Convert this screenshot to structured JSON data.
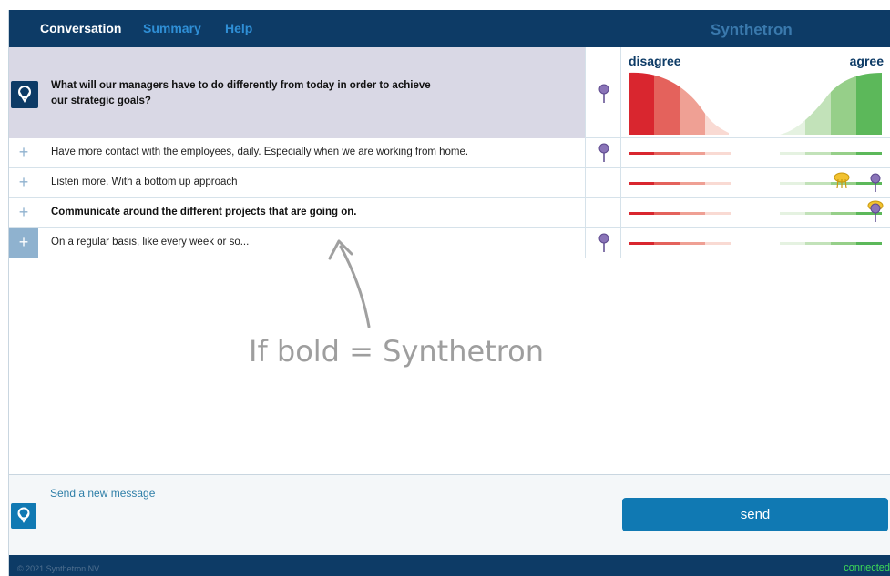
{
  "nav": {
    "tabs": [
      {
        "label": "Conversation",
        "active": true
      },
      {
        "label": "Summary",
        "active": false
      },
      {
        "label": "Help",
        "active": false
      }
    ],
    "brand": "Synthetron"
  },
  "question": {
    "line1": "What will our managers have to do differently from today in order to achieve",
    "line2": "our strategic goals?"
  },
  "scale": {
    "left_label": "disagree",
    "right_label": "agree",
    "colors": {
      "disagree": [
        "#d9262f",
        "#e4625c",
        "#efa094",
        "#f9dad3"
      ],
      "agree": [
        "#e5f2e1",
        "#c2e2b9",
        "#96cf89",
        "#5cb85a"
      ]
    }
  },
  "messages": [
    {
      "text": "Have more contact with the employees, daily. Especially when we are working from home.",
      "bold": false,
      "has_pin": true,
      "agree_markers": []
    },
    {
      "text": "Listen more. With a bottom up approach",
      "bold": false,
      "has_pin": false,
      "agree_markers": [
        "yellow-group",
        "purple"
      ]
    },
    {
      "text": "Communicate around the different projects that are going on.",
      "bold": true,
      "has_pin": false,
      "agree_markers": [
        "yellow-purple"
      ]
    },
    {
      "text": "On a regular basis, like every week or so...",
      "bold": false,
      "has_pin": true,
      "agree_markers": []
    }
  ],
  "annotation": "If bold = Synthetron",
  "composer": {
    "placeholder": "Send a new message",
    "send_label": "send"
  },
  "footer": {
    "copyright": "© 2021 Synthetron NV",
    "status": "connected",
    "status_color": "#3ddc57"
  },
  "icons": {
    "pin": "pin-icon",
    "user": "user-avatar-icon",
    "plus": "plus-icon"
  }
}
